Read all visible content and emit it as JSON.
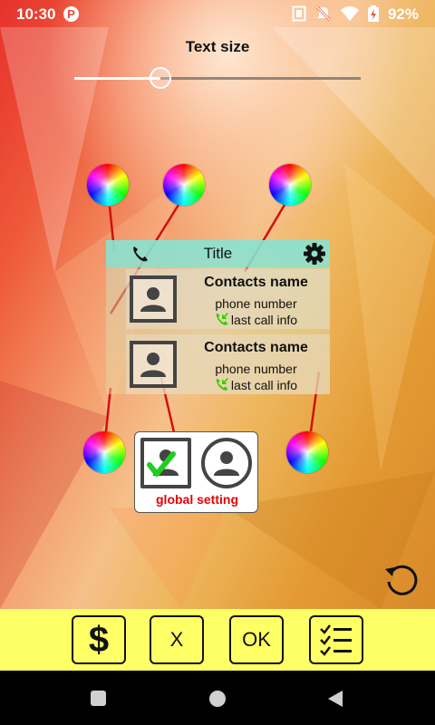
{
  "status": {
    "time": "10:30",
    "app_badge": "P",
    "battery": "92%"
  },
  "editor": {
    "title": "Text size",
    "text_size_level": 0.3
  },
  "widget": {
    "title": "Title",
    "contacts": [
      {
        "name": "Contacts name",
        "phone": "phone number",
        "call_info": "last call info"
      },
      {
        "name": "Contacts name",
        "phone": "phone number",
        "call_info": "last call info"
      }
    ]
  },
  "global_setting": {
    "label": "global setting"
  },
  "bottom_buttons": {
    "donate": "$",
    "cancel": "X",
    "ok": "OK"
  },
  "colors": {
    "accent_red": "#e50000",
    "bar_yellow": "#ffff66",
    "widget_header": "#82e1d2",
    "call_green": "#33cc00"
  }
}
